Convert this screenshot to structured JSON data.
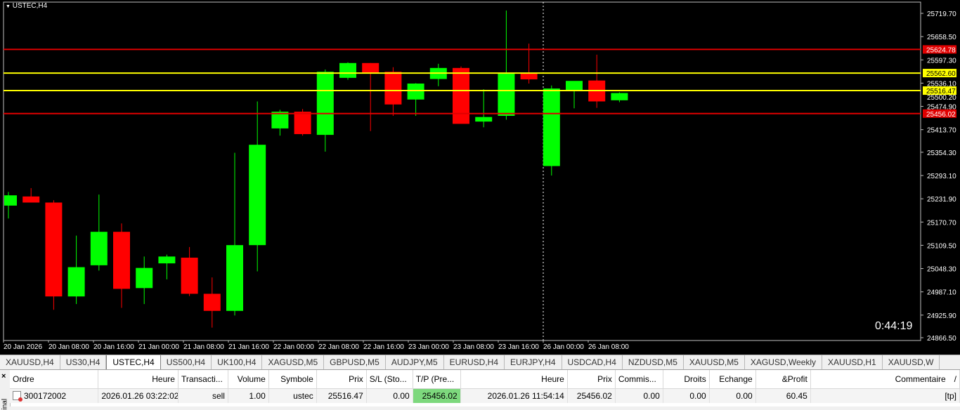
{
  "chart": {
    "title": "USTEC,H4",
    "countdown": "0:44:19",
    "price_ticks": [
      "25719.70",
      "25658.50",
      "25597.30",
      "25536.10",
      "25474.90",
      "25413.70",
      "25354.30",
      "25293.10",
      "25231.90",
      "25170.70",
      "25109.50",
      "25048.30",
      "24987.10",
      "24925.90",
      "24866.50"
    ],
    "time_ticks": [
      "20 Jan 2026",
      "20 Jan 08:00",
      "20 Jan 16:00",
      "21 Jan 00:00",
      "21 Jan 08:00",
      "21 Jan 16:00",
      "22 Jan 00:00",
      "22 Jan 08:00",
      "22 Jan 16:00",
      "23 Jan 00:00",
      "23 Jan 08:00",
      "23 Jan 16:00",
      "26 Jan 00:00",
      "26 Jan 08:00"
    ],
    "price_lines": [
      {
        "label": "25624.78",
        "kind": "sl",
        "color": "#e00000"
      },
      {
        "label": "25562.60",
        "kind": "entry",
        "color": "#ffff00"
      },
      {
        "label": "25516.47",
        "kind": "entry",
        "color": "#ffff00"
      },
      {
        "label": "25456.02",
        "kind": "tp",
        "color": "#e00000"
      }
    ],
    "hidden_tick": "25500.20",
    "bull_color": "#00ff00",
    "bear_color": "#ff0000"
  },
  "chart_data": {
    "type": "candlestick",
    "title": "USTEC,H4",
    "ylim": [
      24866.5,
      25746
    ],
    "candles": [
      {
        "o": 25214,
        "h": 25250,
        "l": 25180,
        "c": 25241
      },
      {
        "o": 25238,
        "h": 25260,
        "l": 25225,
        "c": 25222
      },
      {
        "o": 25222,
        "h": 25228,
        "l": 24940,
        "c": 24975
      },
      {
        "o": 24975,
        "h": 25135,
        "l": 24955,
        "c": 25052
      },
      {
        "o": 25057,
        "h": 25243,
        "l": 25043,
        "c": 25145
      },
      {
        "o": 25145,
        "h": 25167,
        "l": 24945,
        "c": 24995
      },
      {
        "o": 24997,
        "h": 25080,
        "l": 24955,
        "c": 25050
      },
      {
        "o": 25062,
        "h": 25085,
        "l": 25020,
        "c": 25080
      },
      {
        "o": 25077,
        "h": 25105,
        "l": 24976,
        "c": 24982
      },
      {
        "o": 24982,
        "h": 25025,
        "l": 24893,
        "c": 24937
      },
      {
        "o": 24937,
        "h": 25353,
        "l": 24925,
        "c": 25110
      },
      {
        "o": 25110,
        "h": 25488,
        "l": 25041,
        "c": 25374
      },
      {
        "o": 25417,
        "h": 25466,
        "l": 25398,
        "c": 25461
      },
      {
        "o": 25461,
        "h": 25468,
        "l": 25398,
        "c": 25402
      },
      {
        "o": 25400,
        "h": 25572,
        "l": 25356,
        "c": 25566
      },
      {
        "o": 25550,
        "h": 25591,
        "l": 25545,
        "c": 25589
      },
      {
        "o": 25589,
        "h": 25589,
        "l": 25410,
        "c": 25562
      },
      {
        "o": 25566,
        "h": 25578,
        "l": 25450,
        "c": 25480
      },
      {
        "o": 25493,
        "h": 25536,
        "l": 25450,
        "c": 25535
      },
      {
        "o": 25547,
        "h": 25587,
        "l": 25528,
        "c": 25576
      },
      {
        "o": 25576,
        "h": 25580,
        "l": 25430,
        "c": 25429
      },
      {
        "o": 25435,
        "h": 25520,
        "l": 25420,
        "c": 25447
      },
      {
        "o": 25450,
        "h": 25727,
        "l": 25440,
        "c": 25561
      },
      {
        "o": 25562,
        "h": 25640,
        "l": 25535,
        "c": 25546
      },
      {
        "o": 25318,
        "h": 25530,
        "l": 25293,
        "c": 25522
      },
      {
        "o": 25515,
        "h": 25540,
        "l": 25470,
        "c": 25542
      },
      {
        "o": 25543,
        "h": 25611,
        "l": 25471,
        "c": 25488
      },
      {
        "o": 25491,
        "h": 25512,
        "l": 25486,
        "c": 25510
      }
    ]
  },
  "symbol_tabs": [
    "XAUUSD,H4",
    "US30,H4",
    "USTEC,H4",
    "US500,H4",
    "UK100,H4",
    "XAGUSD,M5",
    "GBPUSD,M5",
    "AUDJPY,M5",
    "EURUSD,H4",
    "EURJPY,H4",
    "USDCAD,H4",
    "NZDUSD,M5",
    "XAUUSD,M5",
    "XAGUSD,Weekly",
    "XAUUSD,H1",
    "XAUUSD,W"
  ],
  "active_tab": "USTEC,H4",
  "terminal": {
    "side_label": "inal",
    "close": "×",
    "headers": [
      "Ordre",
      "Heure",
      "Transacti...",
      "Volume",
      "Symbole",
      "Prix",
      "S/L (Sto...",
      "T/P (Pre...",
      "Heure",
      "Prix",
      "Commis...",
      "Droits",
      "Echange",
      "&Profit",
      "Commentaire"
    ],
    "sort_arrow": "/",
    "row": {
      "order": "300172002",
      "open_time": "2026.01.26 03:22:02",
      "type": "sell",
      "volume": "1.00",
      "symbol": "ustec",
      "open_price": "25516.47",
      "sl": "0.00",
      "tp": "25456.02",
      "close_time": "2026.01.26 11:54:14",
      "close_price": "25456.02",
      "commission": "0.00",
      "swap_rights": "0.00",
      "exchange": "0.00",
      "profit": "60.45",
      "comment": "[tp]"
    }
  }
}
